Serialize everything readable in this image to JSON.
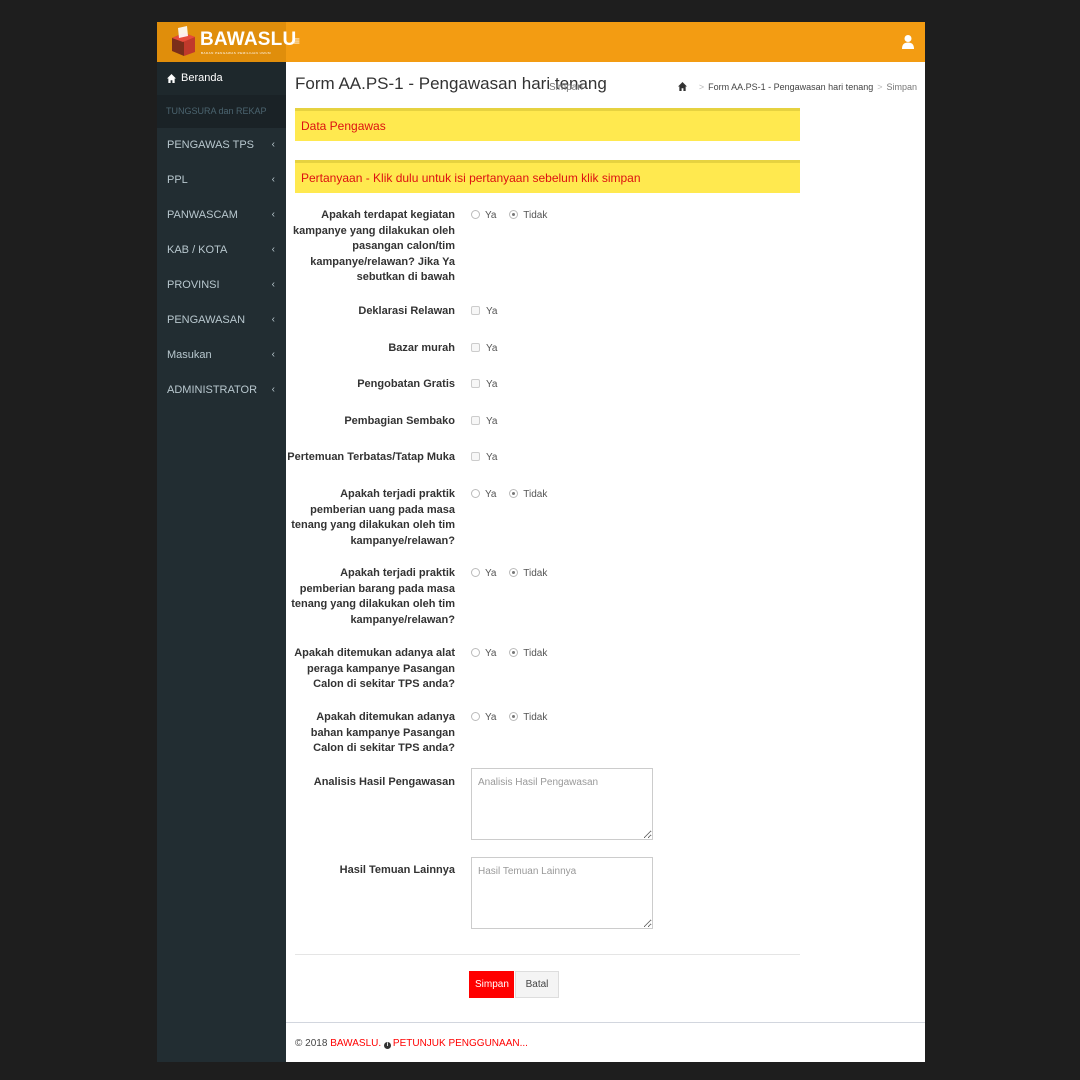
{
  "app": {
    "brand": "BAWASLU",
    "brand_sub": "BADAN PENGAWAS PEMILIHAN UMUM",
    "menu_icon": "hamburger-icon",
    "user_icon": "user-icon"
  },
  "colors": {
    "topbar": "#f39c12",
    "sidebar": "#222d32",
    "section_bar": "#ffe94f",
    "section_text": "#dd1111",
    "primary_button": "#ff0000"
  },
  "sidebar": {
    "home": "Beranda",
    "header": "TUNGSURA dan REKAP",
    "items": [
      {
        "label": "PENGAWAS TPS"
      },
      {
        "label": "PPL"
      },
      {
        "label": "PANWASCAM"
      },
      {
        "label": "KAB / KOTA"
      },
      {
        "label": "PROVINSI"
      },
      {
        "label": "PENGAWASAN"
      },
      {
        "label": "Masukan"
      },
      {
        "label": "ADMINISTRATOR"
      }
    ]
  },
  "header": {
    "title": "Form AA.PS-1 - Pengawasan hari tenang",
    "subtitle": "Simpan",
    "breadcrumb": [
      "Form AA.PS-1 - Pengawasan hari tenang",
      "Simpan"
    ]
  },
  "sections": {
    "data_pengawas": "Data Pengawas",
    "pertanyaan": "Pertanyaan - Klik dulu untuk isi pertanyaan sebelum klik simpan"
  },
  "options": {
    "yes": "Ya",
    "no": "Tidak"
  },
  "questions": {
    "q1": "Apakah terdapat kegiatan kampanye yang dilakukan oleh pasangan calon/tim kampanye/relawan? Jika Ya sebutkan di bawah",
    "c1": "Deklarasi Relawan",
    "c2": "Bazar murah",
    "c3": "Pengobatan Gratis",
    "c4": "Pembagian Sembako",
    "c5": "Pertemuan Terbatas/Tatap Muka",
    "q2": "Apakah terjadi praktik pemberian uang pada masa tenang yang dilakukan oleh tim kampanye/relawan?",
    "q3": "Apakah terjadi praktik pemberian barang pada masa tenang yang dilakukan oleh tim kampanye/relawan?",
    "q4": "Apakah ditemukan adanya alat peraga kampanye Pasangan Calon di sekitar TPS anda?",
    "q5": "Apakah ditemukan adanya bahan kampanye Pasangan Calon di sekitar TPS anda?"
  },
  "answers": {
    "q1": "Tidak",
    "q2": "Tidak",
    "q3": "Tidak",
    "q4": "Tidak",
    "q5": "Tidak",
    "c1": false,
    "c2": false,
    "c3": false,
    "c4": false,
    "c5": false
  },
  "fields": {
    "analisis_label": "Analisis Hasil Pengawasan",
    "analisis_placeholder": "Analisis Hasil Pengawasan",
    "temuan_label": "Hasil Temuan Lainnya",
    "temuan_placeholder": "Hasil Temuan Lainnya"
  },
  "buttons": {
    "save": "Simpan",
    "cancel": "Batal"
  },
  "footer": {
    "copyright": "© 2018",
    "brand_link": "BAWASLU.",
    "help_link": "PETUNJUK PENGGUNAAN..."
  }
}
